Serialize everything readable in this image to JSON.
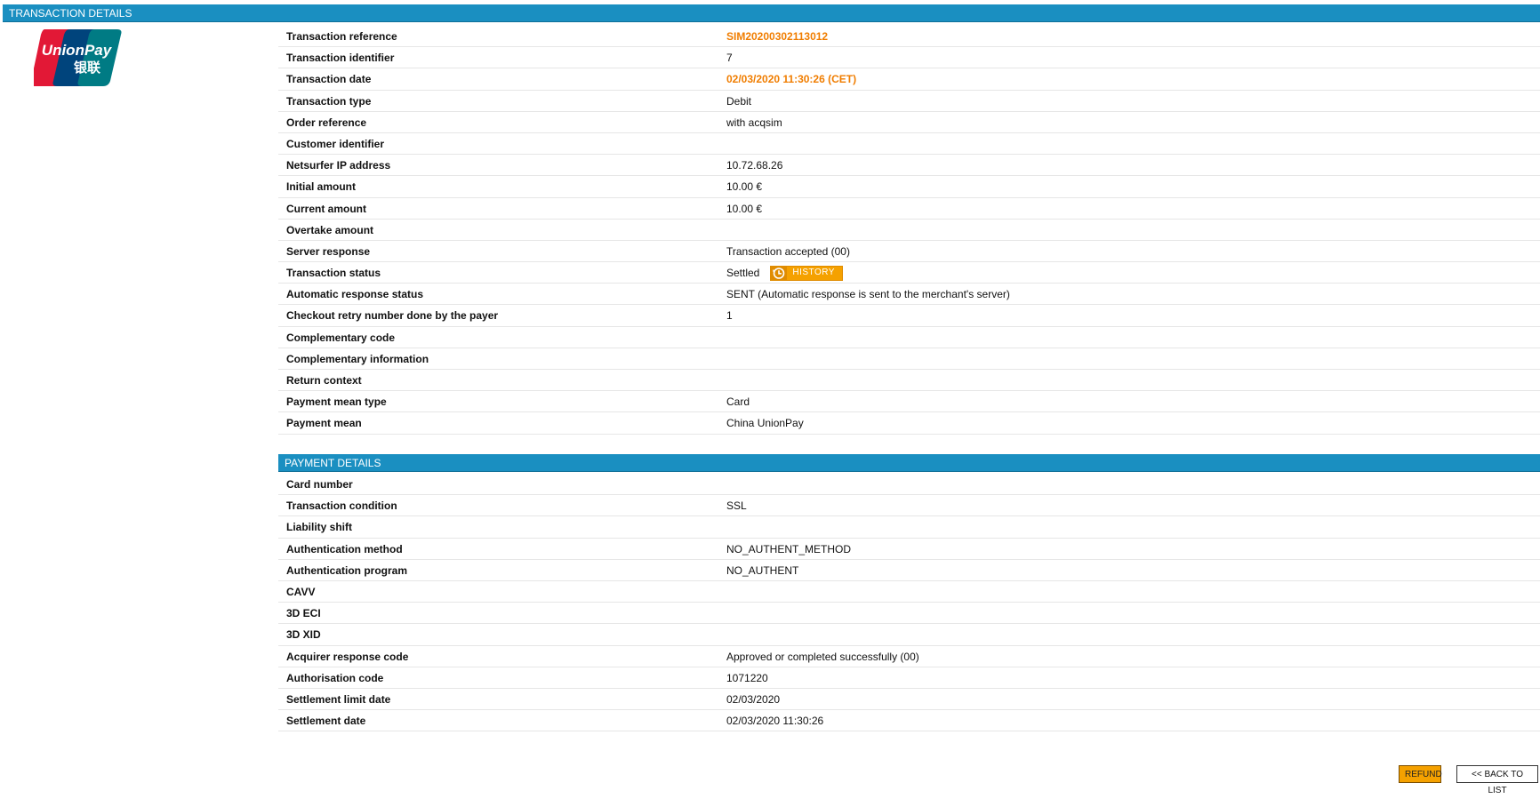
{
  "header": {
    "title": "TRANSACTION DETAILS"
  },
  "logo": {
    "name": "unionpay-logo",
    "brand_text": "UnionPay",
    "chinese_text": "银联",
    "colors": [
      "#e21836",
      "#00447c",
      "#007b84"
    ]
  },
  "transaction": {
    "rows": [
      {
        "label": "Transaction reference",
        "value": "SIM20200302113012",
        "highlight": true
      },
      {
        "label": "Transaction identifier",
        "value": "7"
      },
      {
        "label": "Transaction date",
        "value": "02/03/2020 11:30:26 (CET)",
        "highlight": true
      },
      {
        "label": "Transaction type",
        "value": "Debit"
      },
      {
        "label": "Order reference",
        "value": "with acqsim"
      },
      {
        "label": "Customer identifier",
        "value": ""
      },
      {
        "label": "Netsurfer IP address",
        "value": "10.72.68.26"
      },
      {
        "label": "Initial amount",
        "value": "10.00 €"
      },
      {
        "label": "Current amount",
        "value": "10.00 €"
      },
      {
        "label": "Overtake amount",
        "value": ""
      },
      {
        "label": "Server response",
        "value": "Transaction accepted (00)"
      },
      {
        "label": "Transaction status",
        "value": "Settled",
        "button": "HISTORY"
      },
      {
        "label": "Automatic response status",
        "value": "SENT (Automatic response is sent to the merchant's server)"
      },
      {
        "label": "Checkout retry number done by the payer",
        "value": "1"
      },
      {
        "label": "Complementary code",
        "value": ""
      },
      {
        "label": "Complementary information",
        "value": ""
      },
      {
        "label": "Return context",
        "value": ""
      },
      {
        "label": "Payment mean type",
        "value": "Card"
      },
      {
        "label": "Payment mean",
        "value": "China UnionPay"
      }
    ]
  },
  "payment": {
    "title": "PAYMENT DETAILS",
    "rows": [
      {
        "label": "Card number",
        "value": ""
      },
      {
        "label": "Transaction condition",
        "value": "SSL"
      },
      {
        "label": "Liability shift",
        "value": ""
      },
      {
        "label": "Authentication method",
        "value": "NO_AUTHENT_METHOD"
      },
      {
        "label": "Authentication program",
        "value": "NO_AUTHENT"
      },
      {
        "label": "CAVV",
        "value": ""
      },
      {
        "label": "3D ECI",
        "value": ""
      },
      {
        "label": "3D XID",
        "value": ""
      },
      {
        "label": "Acquirer response code",
        "value": "Approved or completed successfully (00)"
      },
      {
        "label": "Authorisation code",
        "value": "1071220"
      },
      {
        "label": "Settlement limit date",
        "value": "02/03/2020"
      },
      {
        "label": "Settlement date",
        "value": "02/03/2020 11:30:26"
      }
    ]
  },
  "actions": {
    "refund_label": "REFUND",
    "back_label": "<< BACK TO LIST"
  },
  "colors": {
    "header_bg": "#1a8fc1",
    "highlight": "#f07d00",
    "button_orange": "#f5a100"
  },
  "icons": {
    "history": "history-clock-icon"
  }
}
